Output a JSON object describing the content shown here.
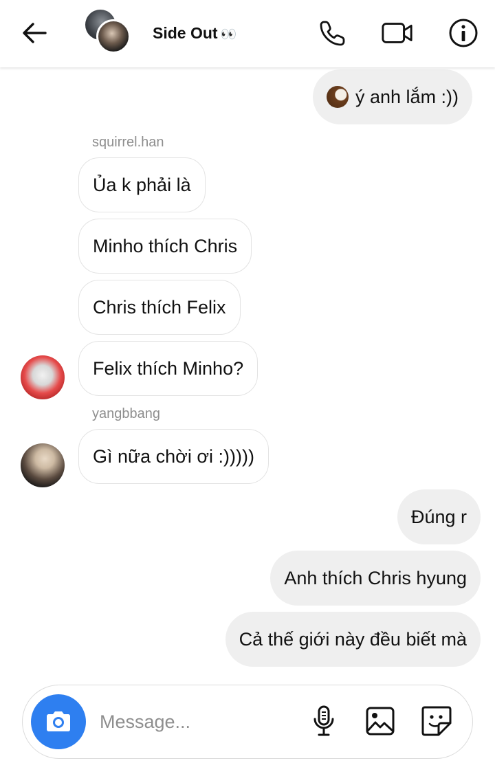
{
  "header": {
    "title": "Side Out",
    "title_emoji": "👀",
    "icons": [
      "back-arrow-icon",
      "phone-icon",
      "video-camera-icon",
      "info-icon"
    ]
  },
  "messages": {
    "out_1": "ý anh lắm :))",
    "sender_1": "squirrel.han",
    "in_1": "Ủa k phải là",
    "in_2": "Minho thích Chris",
    "in_3": "Chris thích Felix",
    "in_4": "Felix thích Minho?",
    "sender_2": "yangbbang",
    "in_5": "Gì nữa chời ơi :)))))",
    "out_2": "Đúng r",
    "out_3": "Anh thích Chris hyung",
    "out_4": "Cả thế giới này đều biết mà"
  },
  "composer": {
    "placeholder": "Message...",
    "value": "",
    "icons": [
      "camera-icon",
      "microphone-icon",
      "gallery-icon",
      "sticker-icon"
    ]
  },
  "colors": {
    "outgoing_bubble": "#efefef",
    "camera_button": "#2e7ff0",
    "secondary_text": "#8e8e8e"
  }
}
